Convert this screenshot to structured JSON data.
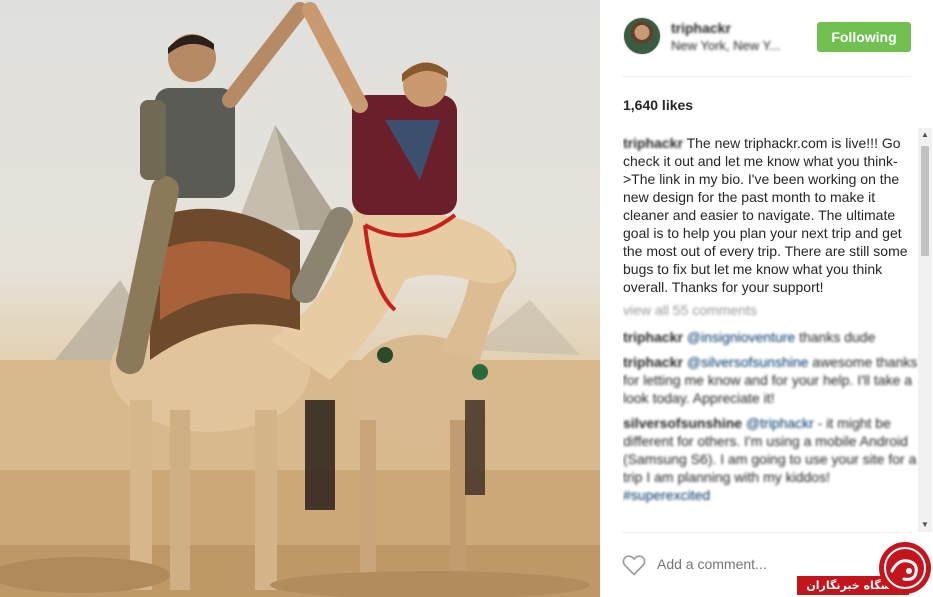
{
  "post": {
    "author": "triphackr",
    "location": "New York, New Y...",
    "follow_label": "Following",
    "likes": "1,640 likes",
    "caption": {
      "author": "triphackr",
      "text": "The new triphackr.com is live!!! Go check it out and let me know what you think->The link in my bio. I've been working on the new design for the past month to make it cleaner and easier to navigate. The ultimate goal is to help you plan your next trip and get the most out of every trip. There are still some bugs to fix but let me know what you think overall. Thanks for your support!"
    },
    "view_all": "view all 55 comments",
    "comments": [
      {
        "user": "triphackr",
        "mention": "@insignioventure",
        "text": " thanks dude"
      },
      {
        "user": "triphackr",
        "mention": "@silversofsunshine",
        "text": " awesome thanks for letting me know and for your help. I'll take a look today. Appreciate it!"
      },
      {
        "user": "silversofsunshine",
        "mention": "@triphackr",
        "text": " - it might be different for others. I'm using a mobile Android (Samsung S6). I am going to use your site for a trip I am planning with my kiddos! ",
        "tag": "#superexcited"
      }
    ],
    "add_comment_placeholder": "Add a comment..."
  },
  "watermark": {
    "text": "باشگاه خبرنگاران"
  },
  "colors": {
    "follow_green": "#70c050",
    "mention_blue": "#003569",
    "watermark_red": "#c4151c"
  },
  "icons": {
    "like": "heart-outline-icon",
    "scroll_up": "scroll-up-arrow-icon",
    "scroll_down": "scroll-down-arrow-icon"
  }
}
